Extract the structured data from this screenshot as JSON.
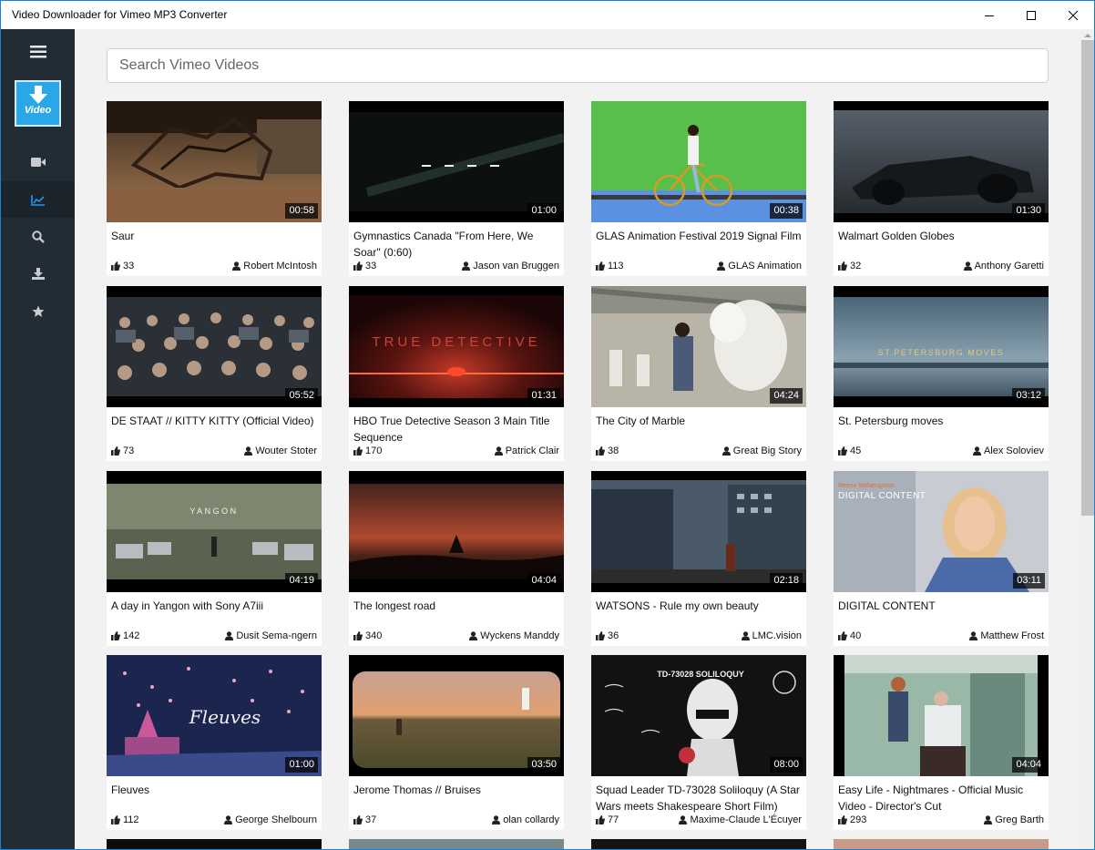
{
  "window": {
    "title": "Video Downloader for Vimeo MP3 Converter"
  },
  "sidebar": {
    "logo_text": "Video",
    "items": [
      {
        "icon": "video-camera-icon"
      },
      {
        "icon": "trending-chart-icon",
        "active": true,
        "color": "#2196f3"
      },
      {
        "icon": "search-icon"
      },
      {
        "icon": "download-icon"
      },
      {
        "icon": "star-icon"
      }
    ]
  },
  "search": {
    "placeholder": "Search Vimeo Videos",
    "value": ""
  },
  "videos": [
    {
      "title": "Saur",
      "duration": "00:58",
      "likes": "33",
      "author": "Robert McIntosh"
    },
    {
      "title": "Gymnastics Canada \"From Here, We Soar\" (0:60)",
      "duration": "01:00",
      "likes": "33",
      "author": "Jason van Bruggen"
    },
    {
      "title": "GLAS Animation Festival 2019 Signal Film",
      "duration": "00:38",
      "likes": "113",
      "author": "GLAS Animation"
    },
    {
      "title": "Walmart Golden Globes",
      "duration": "01:30",
      "likes": "32",
      "author": "Anthony Garetti"
    },
    {
      "title": "DE STAAT // KITTY KITTY (Official Video)",
      "duration": "05:52",
      "likes": "73",
      "author": "Wouter Stoter"
    },
    {
      "title": "HBO True Detective Season 3 Main Title Sequence",
      "duration": "01:31",
      "likes": "170",
      "author": "Patrick Clair"
    },
    {
      "title": "The City of Marble",
      "duration": "04:24",
      "likes": "38",
      "author": "Great Big Story"
    },
    {
      "title": "St. Petersburg moves",
      "duration": "03:12",
      "likes": "45",
      "author": "Alex Soloviev"
    },
    {
      "title": "A day in Yangon with Sony A7iii",
      "duration": "04:19",
      "likes": "142",
      "author": "Dusit Sema-ngern"
    },
    {
      "title": "The longest road",
      "duration": "04:04",
      "likes": "340",
      "author": "Wyckens Manddy"
    },
    {
      "title": "WATSONS - Rule my own beauty",
      "duration": "02:18",
      "likes": "36",
      "author": "LMC.vision"
    },
    {
      "title": "DIGITAL CONTENT",
      "duration": "03:11",
      "likes": "40",
      "author": "Matthew Frost"
    },
    {
      "title": "Fleuves",
      "duration": "01:00",
      "likes": "112",
      "author": "George Shelbourn"
    },
    {
      "title": "Jerome Thomas // Bruises",
      "duration": "03:50",
      "likes": "37",
      "author": "olan collardy"
    },
    {
      "title": "Squad Leader TD-73028 Soliloquy (A Star Wars meets Shakespeare Short Film)",
      "duration": "08:00",
      "likes": "77",
      "author": "Maxime-Claude L'Écuyer"
    },
    {
      "title": "Easy Life - Nightmares - Official Music Video - Director's Cut",
      "duration": "04:04",
      "likes": "293",
      "author": "Greg Barth"
    }
  ],
  "thumb_overlays": {
    "true_detective": "TRUE DETECTIVE",
    "st_petersburg": "ST.PETERSBURG MOVES",
    "yangon": "YANGON",
    "digital_name": "Reese Witherspoon",
    "digital_title": "DIGITAL CONTENT",
    "fleuves": "Fleuves",
    "squad": "TD-73028 SOLILOQUY"
  },
  "colors": {
    "sidebar_bg": "#222c34",
    "accent": "#2196f3",
    "logo_bg": "#2aa7e6"
  }
}
